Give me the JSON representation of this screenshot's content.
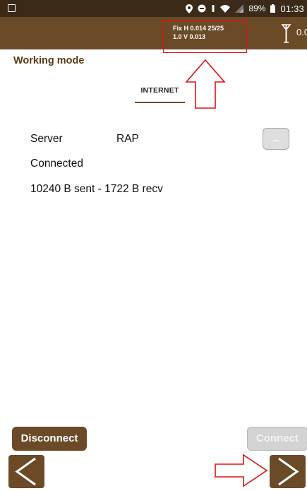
{
  "status_bar": {
    "battery_percent": "89%",
    "time": "01:33",
    "icons": [
      "image-icon",
      "location-pin-icon",
      "data-saver-icon",
      "vibrate-icon",
      "wifi-icon",
      "signal-icon",
      "battery-icon"
    ]
  },
  "toolbar": {
    "fix_line1": "Fix H 0.014  25/25",
    "fix_line2": "1.0 V 0.013",
    "antenna_icon": "antenna-icon",
    "antenna_value": "0.0"
  },
  "page": {
    "title": "Working mode",
    "tab_label": "INTERNET"
  },
  "connection": {
    "server_label": "Server",
    "server_value": "RAP",
    "more_button_label": "...",
    "status": "Connected",
    "traffic": "10240 B sent - 1722 B recv"
  },
  "actions": {
    "disconnect_label": "Disconnect",
    "connect_label": "Connect"
  },
  "navigation": {
    "back_icon": "chevron-left-icon",
    "next_icon": "chevron-right-icon"
  },
  "colors": {
    "status_bar": "#3a2a17",
    "toolbar": "#6b4a27",
    "accent_text": "#5a3b15",
    "annotation": "#e01010",
    "disabled_button": "#d3d3d3"
  }
}
